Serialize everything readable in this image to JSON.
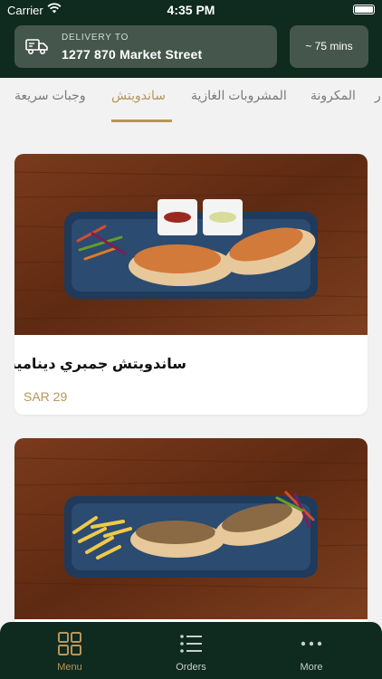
{
  "status_bar": {
    "carrier": "Carrier",
    "time": "4:35 PM"
  },
  "delivery": {
    "label": "DELIVERY TO",
    "address": "1277 870 Market Street",
    "eta": "~ 75 mins"
  },
  "tabs": [
    {
      "label": "وجبات سريعة",
      "active": false
    },
    {
      "label": "ساندويتش",
      "active": true
    },
    {
      "label": "المشروبات الغازية",
      "active": false
    },
    {
      "label": "المكرونة",
      "active": false
    },
    {
      "label": "ر",
      "active": false
    }
  ],
  "products": [
    {
      "name": "ساندويتش جمبري ديناميت",
      "price": "SAR 29"
    },
    {
      "name": "",
      "price": ""
    }
  ],
  "bottom_nav": [
    {
      "label": "Menu",
      "icon": "grid-icon",
      "active": true
    },
    {
      "label": "Orders",
      "icon": "list-icon",
      "active": false
    },
    {
      "label": "More",
      "icon": "more-dots-icon",
      "active": false
    }
  ],
  "colors": {
    "header": "#0f2a1f",
    "accent": "#b9955a",
    "chip": "#45564c",
    "background": "#f2f2f2"
  }
}
